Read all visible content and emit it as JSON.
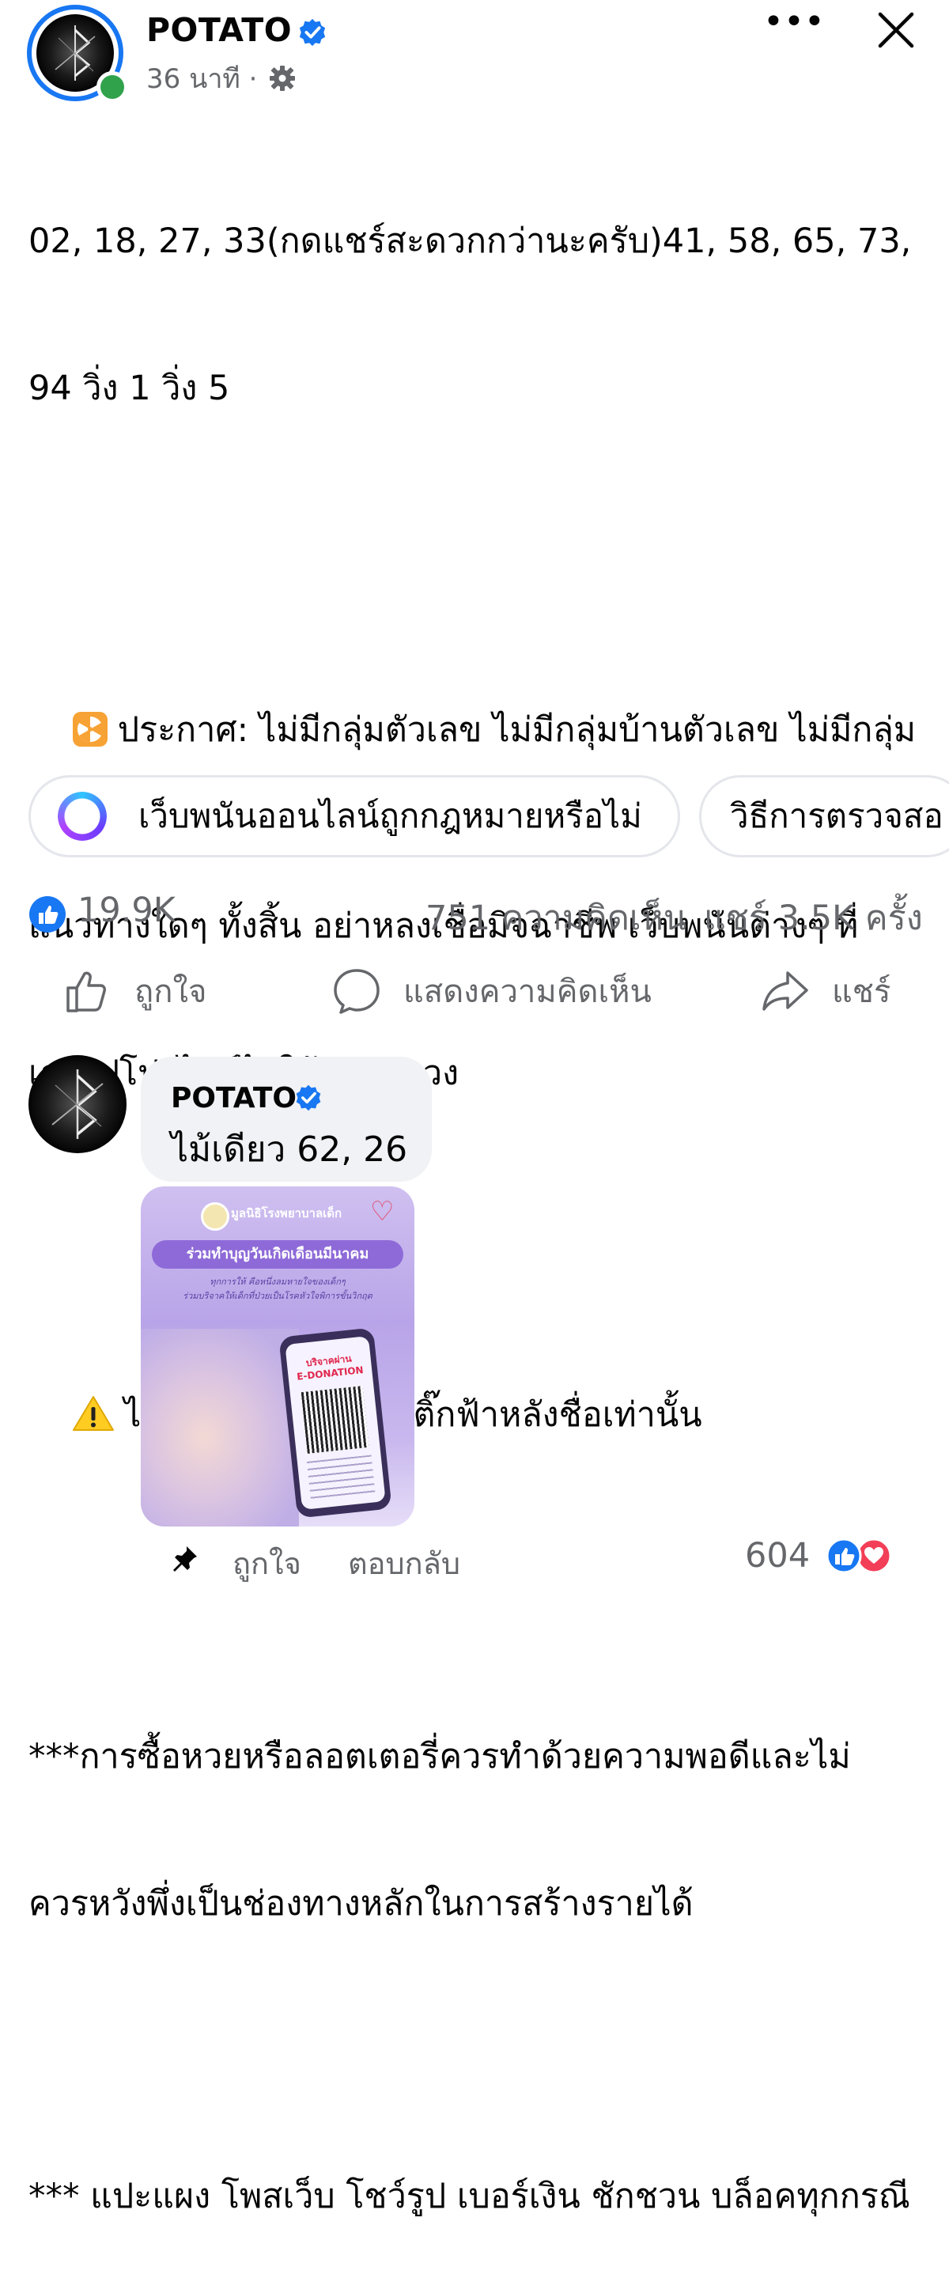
{
  "header": {
    "page_name": "POTATO",
    "post_time": "36 นาที ·"
  },
  "post": {
    "lines": [
      "02, 18, 27, 33(กดแชร์สะดวกกว่านะครับ)41, 58, 65, 73,",
      "94 วิ่ง 1 วิ่ง 5",
      "ประกาศ: ไม่มีกลุ่มตัวเลข ไม่มีกลุ่มบ้านตัวเลข ไม่มีกลุ่ม",
      "แนวทางใดๆ ทั้งสิ้น อย่าหลงเชื่อมิจฉาชีพ เว็บพนันต่างๆ ที่",
      "เอารูปโปรไฟล์ไปใช้หลอกลวง",
      "ไอดีเพจของจริงจะมีติ๊กฟ้าหลังชื่อเท่านั้น",
      "***การซื้อหวยหรือลอตเตอรี่ควรทำด้วยความพอดีและไม่",
      "ควรหวังพึ่งเป็นช่องทางหลักในการสร้างรายได้",
      "*** แปะแผง โพสเว็บ โชว์รูป เบอร์เงิน ชักชวน บล็อคทุกกรณี"
    ]
  },
  "chips": [
    {
      "label": "เว็บพนันออนไลน์ถูกกฎหมายหรือไม่"
    },
    {
      "label": "วิธีการตรวจสอ"
    }
  ],
  "stats": {
    "likes": "19.9K",
    "comments": "751 ความคิดเห็น",
    "shares": "แชร์ 3.5K ครั้ง"
  },
  "actions": {
    "like": "ถูกใจ",
    "comment": "แสดงความคิดเห็น",
    "share": "แชร์"
  },
  "comment": {
    "author": "POTATO",
    "text": "ไม้เดียว 62, 26",
    "image": {
      "org": "มูลนิธิโรงพยาบาลเด็ก",
      "title": "ร่วมทำบุญวันเกิดเดือนมีนาคม",
      "subtitle_1": "ทุกการให้ คือหนึ่งลมหายใจของเด็กๆ",
      "subtitle_2": "ร่วมบริจาคให้เด็กที่ป่วยเป็นโรคหัวใจพิการขั้นวิกฤต",
      "phone_line_1": "บริจาคผ่าน",
      "phone_line_2": "E-DONATION"
    },
    "like_label": "ถูกใจ",
    "reply_label": "ตอบกลับ",
    "reaction_count": "604"
  },
  "colors": {
    "brand_blue": "#1877f2",
    "online_green": "#31a24c",
    "secondary_text": "#65676b",
    "love_red": "#f33e58"
  },
  "icons": [
    "verified-icon",
    "more-icon",
    "close-icon",
    "radioactive-icon",
    "warning-icon",
    "like-icon",
    "comment-icon",
    "share-icon",
    "pin-icon",
    "love-icon"
  ]
}
